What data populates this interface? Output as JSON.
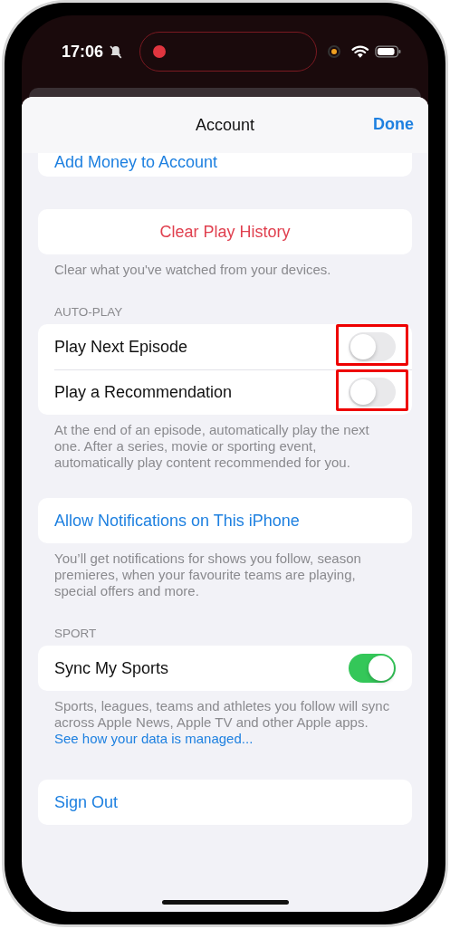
{
  "status_bar": {
    "time": "17:06",
    "silent": true,
    "recording": true
  },
  "header": {
    "title": "Account",
    "done": "Done"
  },
  "add_money": "Add Money to Account",
  "clear_history": {
    "label": "Clear Play History",
    "caption": "Clear what you've watched from your devices."
  },
  "auto_play": {
    "heading": "AUTO-PLAY",
    "rows": [
      {
        "label": "Play Next Episode",
        "on": false,
        "highlighted": true
      },
      {
        "label": "Play a Recommendation",
        "on": false,
        "highlighted": true
      }
    ],
    "caption": "At the end of an episode, automatically play the next one. After a series, movie or sporting event, automatically play content recommended for you."
  },
  "notifications": {
    "label": "Allow Notifications on This iPhone",
    "caption": "You’ll get notifications for shows you follow, season premieres, when your favourite teams are playing, special offers and more."
  },
  "sport": {
    "heading": "SPORT",
    "rows": [
      {
        "label": "Sync My Sports",
        "on": true,
        "highlighted": false
      }
    ],
    "caption": "Sports, leagues, teams and athletes you follow will sync across Apple News, Apple TV and other Apple apps.",
    "link": "See how your data is managed..."
  },
  "sign_out": "Sign Out"
}
